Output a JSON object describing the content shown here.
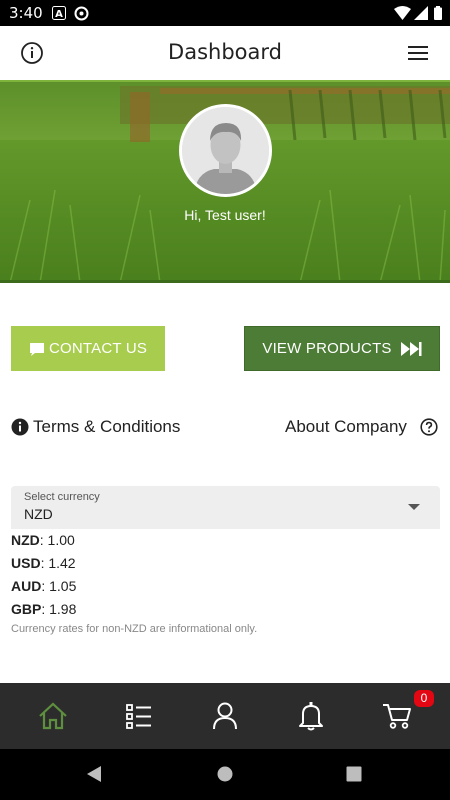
{
  "status_bar": {
    "time": "3:40"
  },
  "app_bar": {
    "title": "Dashboard"
  },
  "hero": {
    "greeting": "Hi, Test user!"
  },
  "actions": {
    "contact_label": "CONTACT US",
    "view_label": "VIEW PRODUCTS"
  },
  "links": {
    "terms_label": "Terms & Conditions",
    "about_label": "About Company"
  },
  "currency": {
    "select_label": "Select currency",
    "selected": "NZD",
    "rates": [
      {
        "code": "NZD",
        "value": ": 1.00"
      },
      {
        "code": "USD",
        "value": ": 1.42"
      },
      {
        "code": "AUD",
        "value": ": 1.05"
      },
      {
        "code": "GBP",
        "value": ": 1.98"
      }
    ],
    "note": "Currency rates for non-NZD are informational only."
  },
  "bottom_nav": {
    "items": [
      "home-icon",
      "list-icon",
      "user-icon",
      "bell-icon",
      "cart-icon"
    ],
    "active": "home-icon",
    "cart_count": "0"
  },
  "colors": {
    "primary_green": "#4d7c36",
    "light_green": "#a8cd4e",
    "nav_background": "#2c2c2c",
    "badge_red": "#e30613"
  }
}
